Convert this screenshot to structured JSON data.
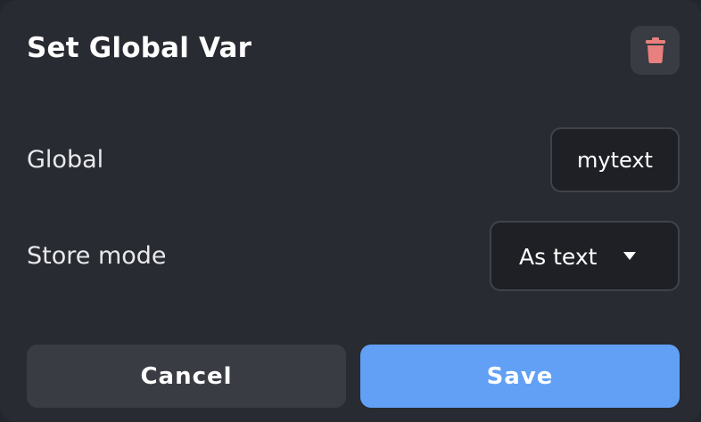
{
  "dialog": {
    "title": "Set Global Var",
    "delete_icon": "trash-icon",
    "delete_icon_color": "#e88080"
  },
  "fields": {
    "global": {
      "label": "Global",
      "value": "mytext"
    },
    "store_mode": {
      "label": "Store mode",
      "selected": "As text",
      "icon": "caret-down-icon"
    }
  },
  "actions": {
    "cancel_label": "Cancel",
    "save_label": "Save"
  },
  "colors": {
    "dialog_bg": "#292b32",
    "input_bg": "#1e2026",
    "secondary_button": "#3a3c43",
    "primary_button": "#61a0f5"
  }
}
